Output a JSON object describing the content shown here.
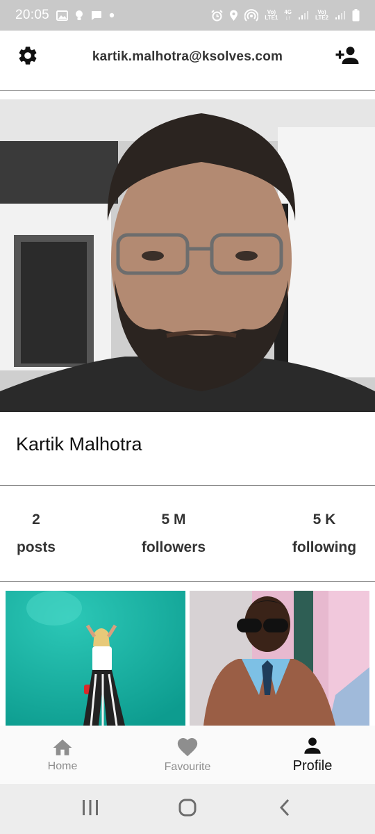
{
  "status_bar": {
    "time": "20:05",
    "left_icons": [
      "gallery-icon",
      "bulb-icon",
      "message-icon",
      "dot-icon"
    ],
    "right_icons": [
      "alarm-icon",
      "location-icon",
      "hotspot-icon",
      "volte1-icon",
      "signal-icon",
      "volte2-icon",
      "signal-icon",
      "battery-icon"
    ],
    "volte1_top": "Vo)",
    "volte1_bottom": "LTE1",
    "network_top": "4G",
    "volte2_top": "Vo)",
    "volte2_bottom": "LTE2"
  },
  "header": {
    "title": "kartik.malhotra@ksolves.com",
    "left_icon": "gear-icon",
    "right_icon": "add-person-icon"
  },
  "profile": {
    "name": "Kartik Malhotra"
  },
  "stats": [
    {
      "value": "2",
      "label": "posts"
    },
    {
      "value": "5 M",
      "label": "followers"
    },
    {
      "value": "5 K",
      "label": "following"
    }
  ],
  "colors": {
    "accent_teal": "#14b3a3",
    "nav_inactive": "#8e8e8e",
    "nav_active": "#111111",
    "status_bar_bg": "#c9c9c9"
  },
  "bottom_nav": [
    {
      "label": "Home",
      "icon": "home-icon",
      "active": false
    },
    {
      "label": "Favourite",
      "icon": "heart-icon",
      "active": false
    },
    {
      "label": "Profile",
      "icon": "person-icon",
      "active": true
    }
  ],
  "system_nav": [
    "recents-icon",
    "home-circle-icon",
    "back-icon"
  ]
}
